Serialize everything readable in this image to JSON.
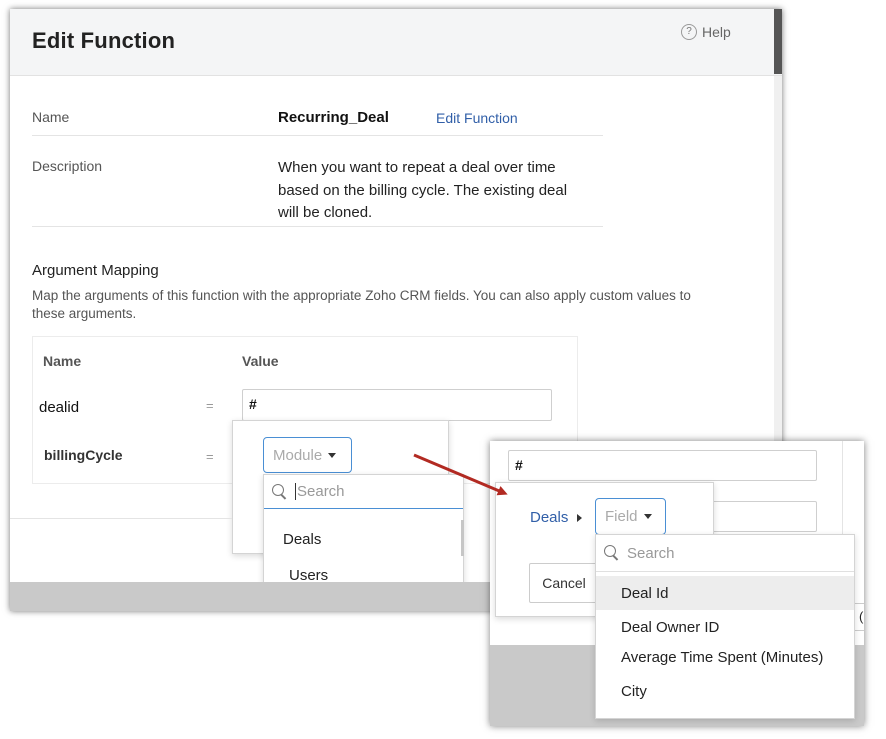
{
  "dialog": {
    "title": "Edit Function",
    "help_label": "Help",
    "help_icon": "?",
    "name_label": "Name",
    "name_value": "Recurring_Deal",
    "edit_function_link": "Edit Function",
    "description_label": "Description",
    "description_lines": [
      "When you want to repeat a deal over time",
      "based on the billing cycle. The existing deal",
      "will be cloned."
    ],
    "argument_mapping": {
      "heading": "Argument Mapping",
      "help_lines": [
        "Map the arguments of this function with the appropriate Zoho CRM fields. You can also apply custom values to",
        "these arguments."
      ],
      "col_name": "Name",
      "col_value": "Value",
      "rows": [
        {
          "name": "dealid",
          "eq": "=",
          "value": "#"
        },
        {
          "name": "billingCycle",
          "eq": "="
        }
      ]
    },
    "module_popup": {
      "select_label": "Module",
      "search_placeholder": "Search",
      "options": [
        "Deals",
        "Users"
      ]
    }
  },
  "zoom": {
    "input_value": "#",
    "breadcrumb_module": "Deals",
    "field_select_label": "Field",
    "search_placeholder": "Search",
    "cancel_label": "Cancel",
    "options": [
      "Deal Id",
      "Deal Owner ID",
      "Average Time Spent (Minutes)",
      "City"
    ],
    "partial_right_glyph": "("
  },
  "colors": {
    "link": "#315fa8",
    "select_border": "#4a8fd4",
    "arrow": "#b22a22",
    "header_bg": "#f4f5f6",
    "highlight": "#ededed"
  }
}
